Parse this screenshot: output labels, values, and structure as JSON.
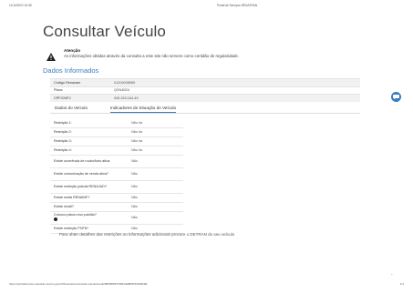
{
  "print_header": {
    "date": "11/10/2022 10:38",
    "title": "Portal de Serviços RENATRAN"
  },
  "page": {
    "title": "Consultar Veículo"
  },
  "warning": {
    "title": "Atenção",
    "text": "As informações obtidas através da consulta a este site não servem como certidão de regularidade."
  },
  "section": {
    "title": "Dados Informados"
  },
  "info": {
    "rows": [
      {
        "label": "Código Renavam",
        "value": "01204008565"
      },
      {
        "label": "Placa",
        "value": "QSN4B24"
      },
      {
        "label": "CPF/CNPJ",
        "value": "006.263.164-49"
      }
    ]
  },
  "tabs": [
    {
      "label": "Dados do Veículo",
      "active": false
    },
    {
      "label": "Indicadores de Situação do Veículo",
      "active": true
    }
  ],
  "status": {
    "rows": [
      {
        "label": "Restrição 1:",
        "value": "Não há"
      },
      {
        "label": "Restrição 2:",
        "value": "Não há"
      },
      {
        "label": "Restrição 3:",
        "value": "Não há"
      },
      {
        "label": "Restrição 4:",
        "value": "Não há"
      },
      {
        "label": "Existe ocorrência de roubo/furto ativa:",
        "value": "Não"
      },
      {
        "label": "Existe comunicação de venda ativa?",
        "value": "Não"
      },
      {
        "label": "Existe restrição judicial RENAJUD?",
        "value": "Não"
      },
      {
        "label": "Existe multa RENAINF?",
        "value": "Não"
      },
      {
        "label": "Existe recall?",
        "value": "Não"
      },
      {
        "label": "Colocou placa novo padrão?",
        "value": "Não"
      },
      {
        "label": "Existe restrição PGFN*",
        "value": "Não"
      }
    ]
  },
  "bottom_note": "Para obter detalhes das restrições ou informações adicionais procure o DETRAN do seu veículo",
  "print_footer": {
    "url": "https://portalservicos.senatran.serpro.gov.br/#/veiculos/consultar-veiculo/result/58005DB7F66FAE9B/0152600F9E",
    "page": "1/1"
  },
  "icons": {
    "warning": "warning-triangle-icon",
    "fab": "chat-icon",
    "info": "info-circle-icon"
  },
  "colors": {
    "accent": "#3a7cc1"
  }
}
